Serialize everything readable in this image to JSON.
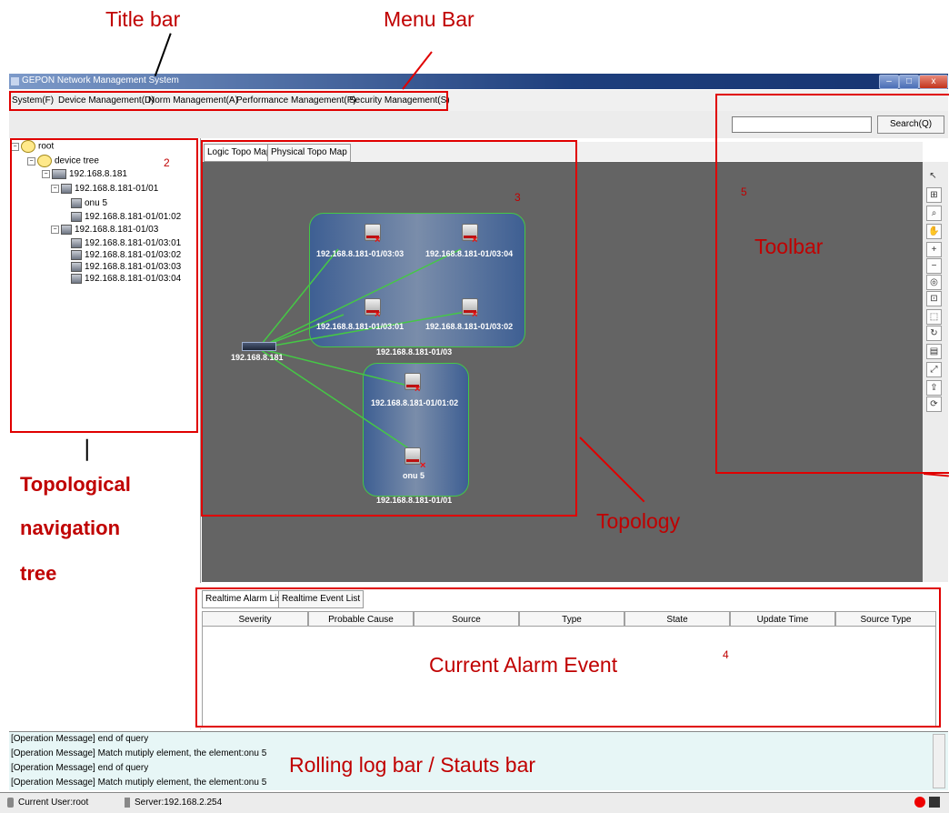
{
  "annotations": {
    "title_bar": "Title bar",
    "menu_bar": "Menu Bar",
    "nav_tree_1": "Topological",
    "nav_tree_2": "navigation",
    "nav_tree_3": "tree",
    "toolbar": "Toolbar",
    "topology": "Topology",
    "alarm": "Current Alarm Event",
    "log": "Rolling log bar / Stauts bar",
    "n2": "2",
    "n3": "3",
    "n4": "4",
    "n5": "5"
  },
  "window": {
    "title": "GEPON Network Management System",
    "min": "–",
    "max": "□",
    "close": "x"
  },
  "menu": [
    "System(F)",
    "Device Management(D)",
    "Norm Management(A)",
    "Performance Management(P)",
    "Security Management(S)"
  ],
  "search": {
    "value": "",
    "button": "Search(Q)"
  },
  "tree": {
    "root": "root",
    "device_tree": "device tree",
    "olt": "192.168.8.181",
    "pon1": "192.168.8.181-01/01",
    "onu5": "onu 5",
    "onu_0102": "192.168.8.181-01/01:02",
    "pon3": "192.168.8.181-01/03",
    "onu_0301": "192.168.8.181-01/03:01",
    "onu_0302": "192.168.8.181-01/03:02",
    "onu_0303": "192.168.8.181-01/03:03",
    "onu_0304": "192.168.8.181-01/03:04"
  },
  "topo_tabs": [
    "Logic Topo Map",
    "Physical Topo Map"
  ],
  "topo": {
    "olt": "192.168.8.181",
    "group_top": "192.168.8.181-01/03",
    "group_bottom": "192.168.8.181-01/01",
    "n0303": "192.168.8.181-01/03:03",
    "n0304": "192.168.8.181-01/03:04",
    "n0301": "192.168.8.181-01/03:01",
    "n0302": "192.168.8.181-01/03:02",
    "n0102": "192.168.8.181-01/01:02",
    "onu5": "onu 5"
  },
  "tools": [
    "pointer-icon",
    "zoom-region-icon",
    "magnifier-icon",
    "pan-hand-icon",
    "zoom-in-icon",
    "zoom-out-icon",
    "zoom-reset-icon",
    "fit-icon",
    "select-icon",
    "rotate-icon",
    "layout-icon",
    "expand-icon",
    "export-icon",
    "refresh-icon"
  ],
  "alarm_tabs": [
    "Realtime Alarm List",
    "Realtime Event List"
  ],
  "alarm_columns": [
    "Severity",
    "Probable Cause",
    "Source",
    "Type",
    "State",
    "Update Time",
    "Source Type"
  ],
  "log_lines": [
    "[Operation Message]  end of query",
    "[Operation Message]  Match mutiply element, the element:onu 5",
    "[Operation Message]  end of query",
    "[Operation Message]  Match mutiply element, the element:onu 5"
  ],
  "status": {
    "user": "Current User:root",
    "server": "Server:192.168.2.254"
  },
  "colors": {
    "annotation": "#c00000",
    "topo_bg": "#646464",
    "link": "#45c845",
    "log_bg": "#e7f6f6"
  }
}
